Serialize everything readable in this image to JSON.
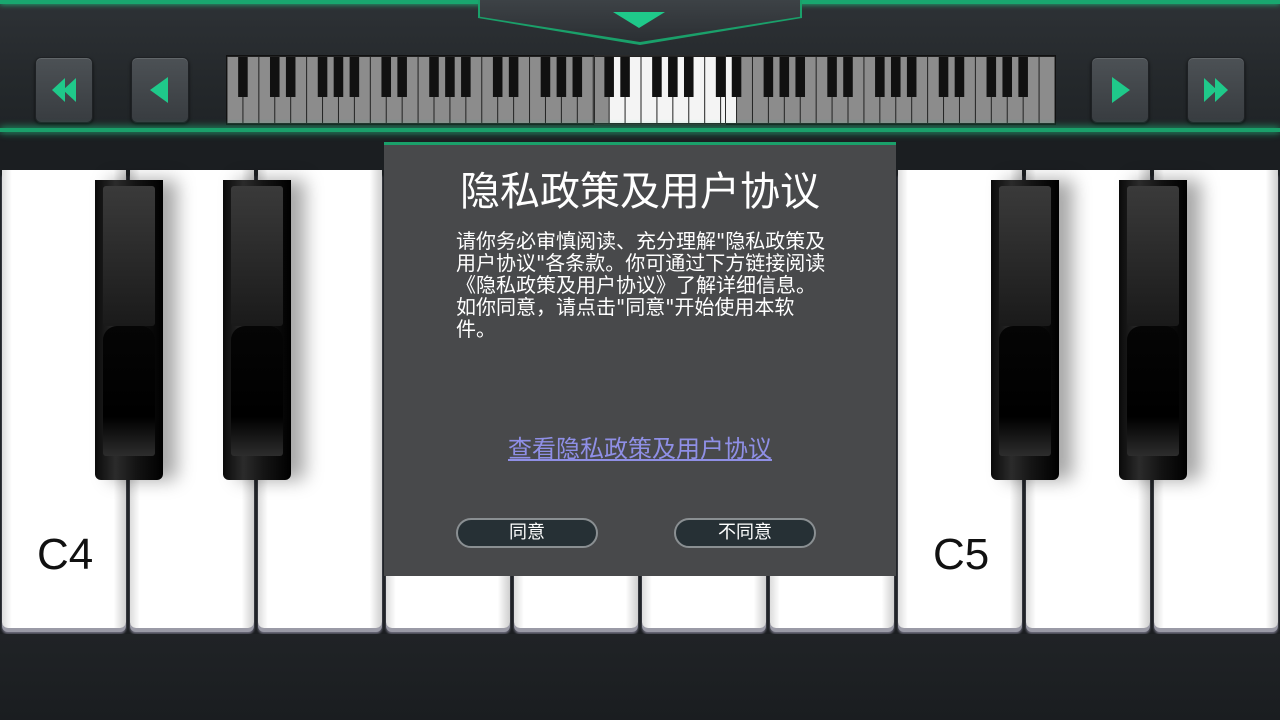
{
  "toolbar": {
    "buttons": {
      "fast_rewind_icon": "double-left-arrow",
      "prev_icon": "left-arrow",
      "next_icon": "right-arrow",
      "fast_forward_icon": "double-right-arrow"
    },
    "accent_color": "#1fc98a"
  },
  "piano": {
    "labels": {
      "left": "C4",
      "right": "C5"
    }
  },
  "dialog": {
    "title": "隐私政策及用户协议",
    "body": "请你务必审慎阅读、充分理解\"隐私政策及用户协议\"各条款。你可通过下方链接阅读《隐私政策及用户协议》了解详细信息。\n如你同意，请点击\"同意\"开始使用本软件。",
    "link": "查看隐私政策及用户协议",
    "agree_label": "同意",
    "disagree_label": "不同意",
    "link_color": "#8f8fe6"
  }
}
